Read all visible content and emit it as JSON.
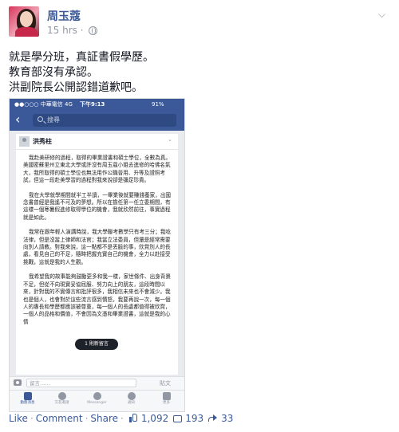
{
  "post": {
    "author": "周玉蔻",
    "time": "15 hrs",
    "separator": "·",
    "text_lines": [
      "就是學分班，真証書假學歷。",
      "教育部沒有承認。",
      "洪副院長公開認錯道歉吧。"
    ]
  },
  "screenshot": {
    "status": {
      "carrier": "●●○○○ 中華電信  4G",
      "time": "下午9:13",
      "battery": "91%"
    },
    "search_placeholder": "搜尋",
    "card_author": "洪秀柱",
    "paragraphs": [
      "我赴美研修的過程，取得的畢業證書和碩士學位，全數為真。美國密蘇里州立東北大學或許沒有周玉蔻小姐去進修的哈佛名氣大，我所取得的碩士學位也無法用作公職晉用、升等及證照考試，但這一段赴美學習的過程對我來說卻是彌足珍貴。",
      "我在大學就學期間就半工半讀，一畢業後就要賺錢養家，出國念書曾經是我遙不可及的夢想。所以在擔任第一任立委期間，有這樣一個寒暑假進修取得學位的機會，我就欣然前往，事實過程就是如此。",
      "我常在跟年輕人演講時說，我大學聯考數學只有考三分；我唸法律，但是沒當上律師和法官；我當立法委員，但還是經常需要向別人請教。對我來說，這一點都不是丟臉的事，欣賞別人的長處，看見自己的不足，隨時把握充實自己的機會，全力以赴接受挑戰，這就是我的人生觀。",
      "我希望我的故事能夠鼓勵更多和我一樣，家世條件、出身背景不足，但從不向現實妥協屈服、努力向上的朋友，這段時間以來，針對我的不實傳言和批評很多，我相信未來也不會減少。我也是個人，也會對於這些流言感到憤怒，我要再說一次，每一個人的專長和學歷都應該被尊重，每一個人的長處都值得被欣賞，一個人的品格和價值，不會因為文憑和畢業證書，這就是我的心情"
    ],
    "toast": "1 則新留言",
    "comment_placeholder": "留言……",
    "send_label": "貼文",
    "tabs": [
      "動態消息",
      "交友邀請",
      "Messenger",
      "通知",
      "更多"
    ]
  },
  "actions": {
    "like": "Like",
    "comment": "Comment",
    "share": "Share",
    "separator": "·",
    "likes_count": "1,092",
    "comments_count": "193",
    "shares_count": "33"
  },
  "colors": {
    "brand": "#3b5998",
    "muted": "#9197a3",
    "text": "#141823"
  },
  "icons": [
    "globe-icon",
    "chevron-down-icon",
    "back-arrow-icon",
    "search-icon",
    "camera-icon",
    "news-feed-icon",
    "friends-icon",
    "messenger-icon",
    "globe-notification-icon",
    "more-icon",
    "like-thumb-icon",
    "comment-bubble-icon",
    "share-arrow-icon"
  ]
}
